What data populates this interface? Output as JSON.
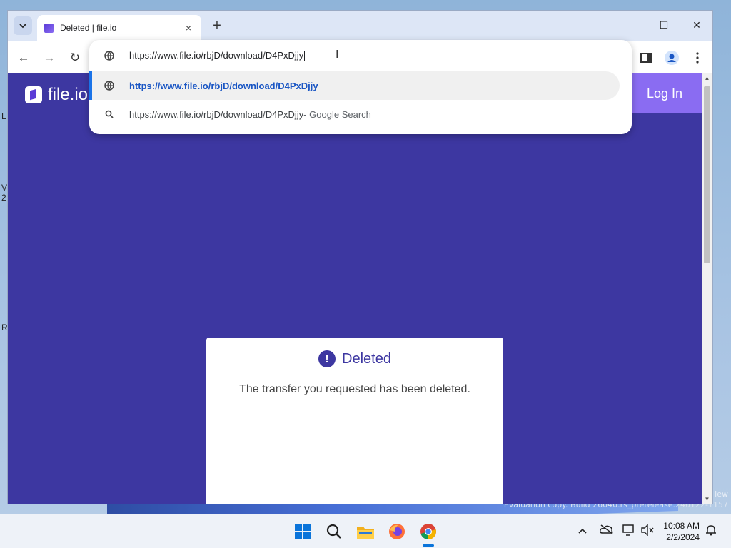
{
  "window": {
    "tab_title": "Deleted | file.io",
    "tab_close": "×",
    "new_tab": "+",
    "minimize": "–",
    "maximize": "☐",
    "close": "✕"
  },
  "toolbar": {
    "back": "←",
    "forward": "→",
    "reload": "↻"
  },
  "omnibox": {
    "input_value": "https://www.file.io/rbjD/download/D4PxDjjy",
    "suggestions": [
      {
        "text": "https://www.file.io/rbjD/download/D4PxDjjy",
        "icon": "globe-icon"
      },
      {
        "text": "https://www.file.io/rbjD/download/D4PxDjjy",
        "suffix": " - Google Search",
        "icon": "search-icon"
      }
    ]
  },
  "site": {
    "logo_text": "file.io",
    "login_label": "Log In",
    "card_title": "Deleted",
    "card_message": "The transfer you requested has been deleted.",
    "brand_color": "#3d37a1",
    "accent_color": "#8a6cf2"
  },
  "desktop": {
    "watermark_line1": "iew",
    "watermark_line2": "Evaluation copy. Build 26040.rs_prerelease.240122-1157",
    "edge_text_1": "L",
    "edge_text_2": "V",
    "edge_text_3": "2",
    "edge_text_4": "R"
  },
  "taskbar": {
    "time": "10:08 AM",
    "date": "2/2/2024",
    "apps": [
      "start-icon",
      "search-icon",
      "file-explorer-icon",
      "firefox-icon",
      "chrome-icon"
    ]
  }
}
